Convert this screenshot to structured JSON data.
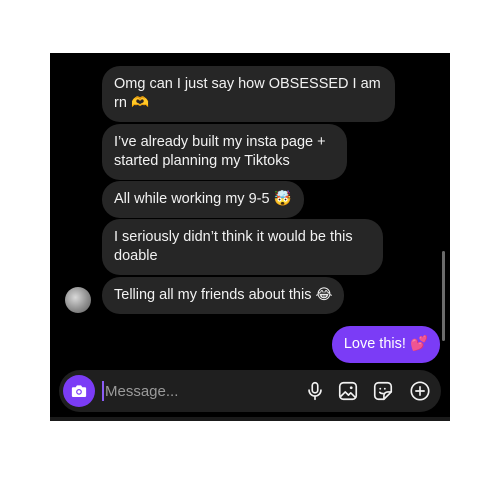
{
  "messages": [
    {
      "text": "Omg can I just say how OBSESSED I am rn",
      "emoji": "🫶"
    },
    {
      "text": "I’ve already built my insta page + started planning my Tiktoks",
      "emoji": ""
    },
    {
      "text": "All while working my 9-5",
      "emoji": "🤯"
    },
    {
      "text": "I seriously didn’t think it would be this doable",
      "emoji": ""
    },
    {
      "text": "Telling all my friends about this",
      "emoji": "😂"
    },
    {
      "text": "Love this!",
      "emoji": "💕",
      "sent": true
    }
  ],
  "composer": {
    "placeholder": "Message..."
  },
  "icons": {
    "camera": "camera-icon",
    "microphone": "microphone-icon",
    "gallery": "gallery-icon",
    "sticker": "sticker-icon",
    "add": "add-icon"
  },
  "colors": {
    "background": "#000000",
    "received_bubble": "#262626",
    "sent_bubble": "#7b3cf6",
    "accent": "#7b3cf6"
  }
}
